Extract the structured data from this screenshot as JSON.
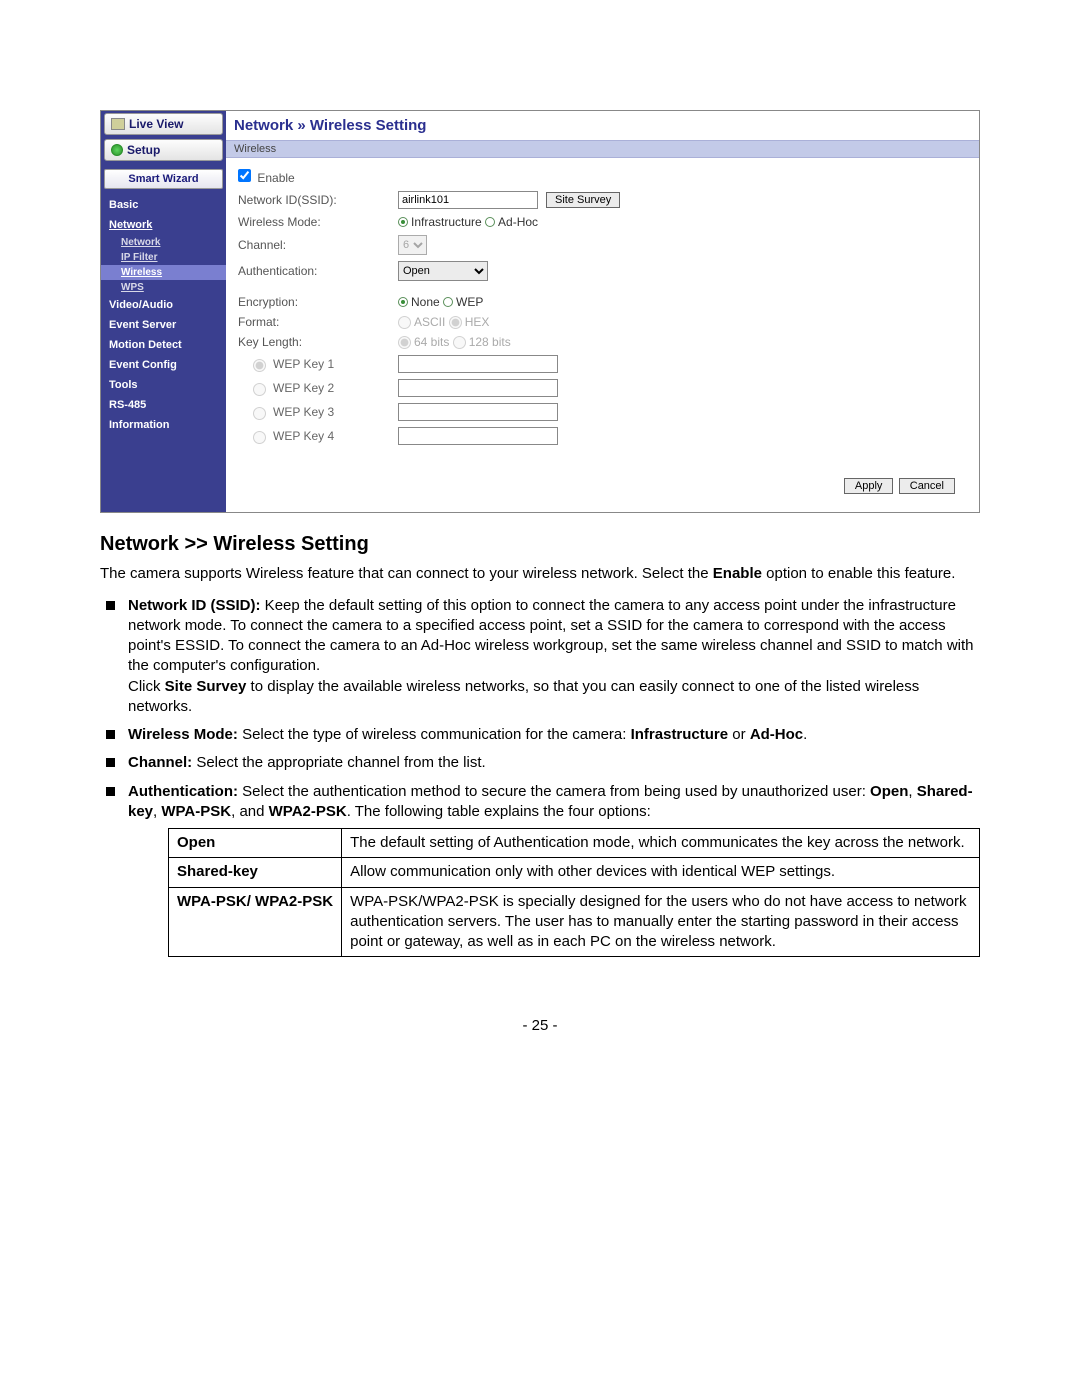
{
  "sidebar": {
    "live_view": "Live View",
    "setup": "Setup",
    "smart_wizard": "Smart Wizard",
    "items": [
      {
        "label": "Basic"
      },
      {
        "label": "Network",
        "link": true,
        "sub": [
          {
            "label": "Network"
          },
          {
            "label": "IP Filter"
          },
          {
            "label": "Wireless",
            "active": true
          },
          {
            "label": "WPS"
          }
        ]
      },
      {
        "label": "Video/Audio"
      },
      {
        "label": "Event Server"
      },
      {
        "label": "Motion Detect"
      },
      {
        "label": "Event Config"
      },
      {
        "label": "Tools"
      },
      {
        "label": "RS-485"
      },
      {
        "label": "Information"
      }
    ]
  },
  "breadcrumb": {
    "root": "Network",
    "sep": "»",
    "leaf": "Wireless Setting"
  },
  "section_bar": "Wireless",
  "form": {
    "enable_label": "Enable",
    "ssid_label": "Network ID(SSID):",
    "ssid_value": "airlink101",
    "site_survey": "Site Survey",
    "mode_label": "Wireless Mode:",
    "mode_infra": "Infrastructure",
    "mode_adhoc": "Ad-Hoc",
    "channel_label": "Channel:",
    "channel_value": "6",
    "auth_label": "Authentication:",
    "auth_value": "Open",
    "enc_label": "Encryption:",
    "enc_none": "None",
    "enc_wep": "WEP",
    "format_label": "Format:",
    "format_ascii": "ASCII",
    "format_hex": "HEX",
    "keylen_label": "Key Length:",
    "keylen_64": "64 bits",
    "keylen_128": "128 bits",
    "wep1": "WEP Key 1",
    "wep2": "WEP Key 2",
    "wep3": "WEP Key 3",
    "wep4": "WEP Key 4",
    "apply": "Apply",
    "cancel": "Cancel"
  },
  "doc": {
    "heading": "Network >> Wireless Setting",
    "intro_a": "The camera supports Wireless feature that can connect to your wireless network. Select the ",
    "intro_b_bold": "Enable",
    "intro_c": " option to enable this feature.",
    "li_ssid_bold": "Network ID (SSID):",
    "li_ssid_text": " Keep the default setting of this option to connect the camera to any access point under the infrastructure network mode. To connect the camera to a specified access point, set a SSID for the camera to correspond with the access point's ESSID. To connect the camera to an Ad-Hoc wireless workgroup, set the same wireless channel and SSID to match with the computer's configuration.",
    "li_ssid_p2a": "Click ",
    "li_ssid_p2_bold": "Site Survey",
    "li_ssid_p2b": " to display the available wireless networks, so that you can easily connect to one of the listed wireless networks.",
    "li_mode_bold": "Wireless Mode:",
    "li_mode_text_a": " Select the type of wireless communication for the camera: ",
    "li_mode_b1": "Infrastructure",
    "li_mode_or": " or ",
    "li_mode_b2": "Ad-Hoc",
    "li_mode_end": ".",
    "li_channel_bold": "Channel:",
    "li_channel_text": " Select the appropriate channel from the list.",
    "li_auth_bold": "Authentication:",
    "li_auth_text_a": " Select the authentication method to secure the camera from being used by unauthorized user: ",
    "li_auth_b1": "Open",
    "li_auth_c1": ", ",
    "li_auth_b2": "Shared-key",
    "li_auth_c2": ", ",
    "li_auth_b3": "WPA-PSK",
    "li_auth_c3": ", and ",
    "li_auth_b4": "WPA2-PSK",
    "li_auth_text_b": ". The following table explains the four options:",
    "table": {
      "r1k": "Open",
      "r1v": "The default setting of Authentication mode, which communicates the key across the network.",
      "r2k": "Shared-key",
      "r2v": "Allow communication only with other devices with identical WEP settings.",
      "r3k": "WPA-PSK/ WPA2-PSK",
      "r3v": "WPA-PSK/WPA2-PSK is specially designed for the users who do not have access to network authentication servers. The user has to manually enter the starting password in their access point or gateway, as well as in each PC on the wireless network."
    },
    "pagenum": "- 25 -"
  }
}
